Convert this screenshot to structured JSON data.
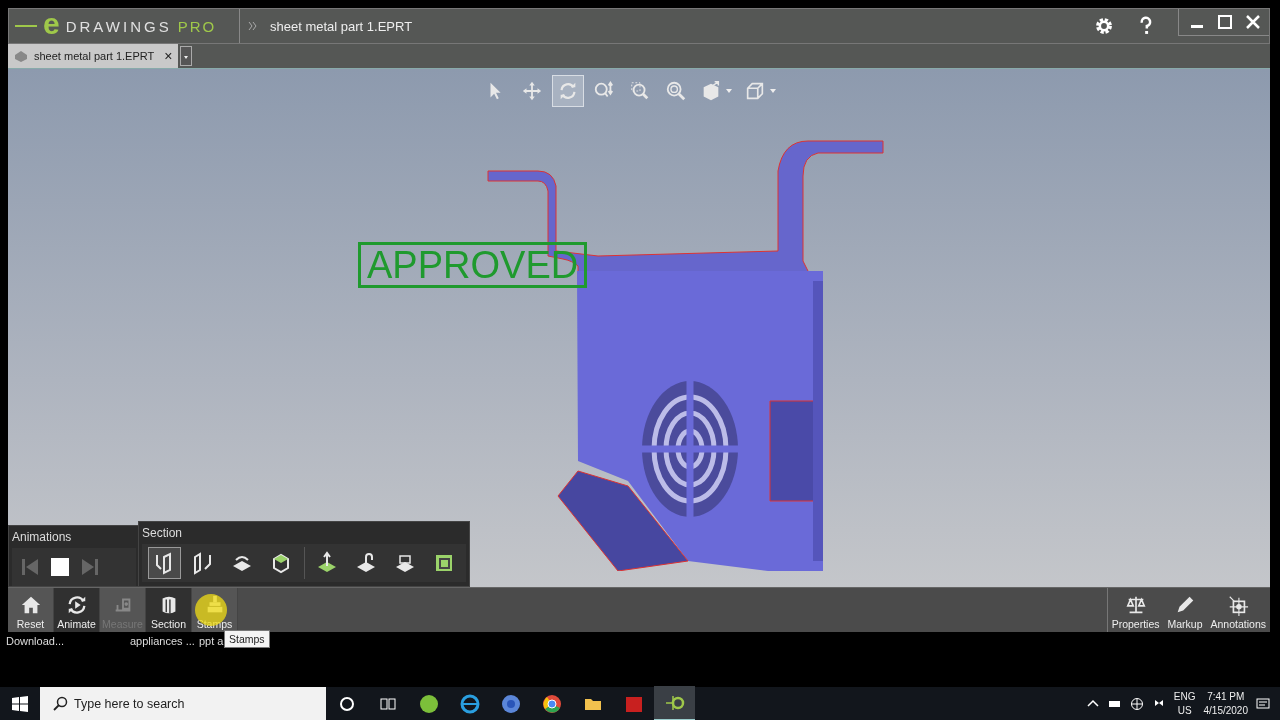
{
  "app": {
    "logo_mark": "e",
    "logo_word": "DRAWINGS",
    "logo_edition": "PRO",
    "document_title": "sheet metal part 1.EPRT"
  },
  "tabs": [
    {
      "label": "sheet metal part 1.EPRT",
      "selected": true,
      "close": "×"
    }
  ],
  "view_toolbar": [
    {
      "selected": false
    },
    {
      "selected": false
    },
    {
      "selected": true
    },
    {
      "selected": false
    },
    {
      "selected": false
    },
    {
      "selected": false
    },
    {
      "selected": false,
      "dropdown": true
    },
    {
      "selected": false,
      "dropdown": true
    }
  ],
  "stamp": {
    "text": "APPROVED"
  },
  "animations_panel": {
    "title": "Animations"
  },
  "section_panel": {
    "title": "Section",
    "tools": [
      {
        "selected": true
      },
      {
        "selected": false
      },
      {
        "selected": false
      },
      {
        "selected": false
      },
      {
        "selected": false
      },
      {
        "selected": false
      },
      {
        "selected": false
      },
      {
        "selected": false
      }
    ]
  },
  "bottom_tools": [
    {
      "label": "Reset",
      "selected": false,
      "disabled": false
    },
    {
      "label": "Animate",
      "selected": true,
      "disabled": false
    },
    {
      "label": "Measure",
      "selected": false,
      "disabled": true
    },
    {
      "label": "Section",
      "selected": true,
      "disabled": false
    },
    {
      "label": "Stamps",
      "selected": false,
      "disabled": false
    }
  ],
  "right_tools": [
    {
      "label": "Properties"
    },
    {
      "label": "Markup"
    },
    {
      "label": "Annotations"
    }
  ],
  "tooltip": "Stamps",
  "background_labels": [
    "Download...",
    "appliances ...",
    "ppt a"
  ],
  "taskbar": {
    "search_placeholder": "Type here to search",
    "language": "ENG",
    "region": "US",
    "time": "7:41 PM",
    "date": "4/15/2020"
  }
}
